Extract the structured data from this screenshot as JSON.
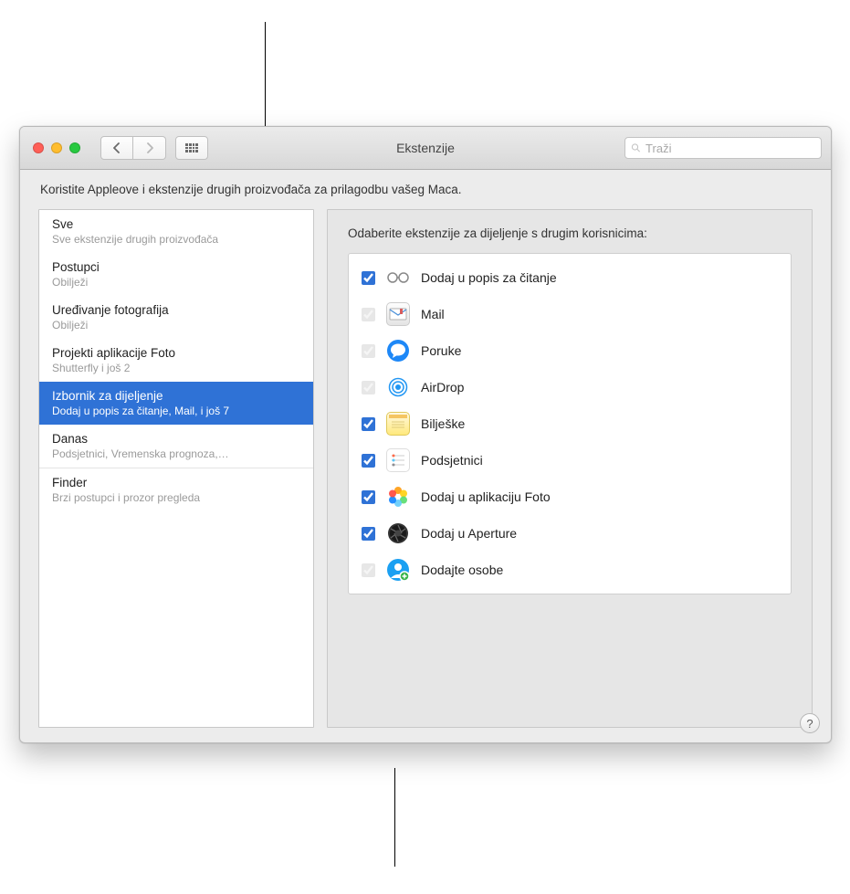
{
  "window": {
    "title": "Ekstenzije"
  },
  "search": {
    "placeholder": "Traži"
  },
  "description": "Koristite Appleove i ekstenzije drugih proizvođača za prilagodbu vašeg Maca.",
  "sidebar": {
    "items": [
      {
        "title": "Sve",
        "sub": "Sve ekstenzije drugih proizvođača"
      },
      {
        "title": "Postupci",
        "sub": "Obilježi"
      },
      {
        "title": "Uređivanje fotografija",
        "sub": "Obilježi"
      },
      {
        "title": "Projekti aplikacije Foto",
        "sub": "Shutterfly i još 2"
      },
      {
        "title": "Izbornik za dijeljenje",
        "sub": "Dodaj u popis za čitanje, Mail, i još 7",
        "selected": true
      },
      {
        "title": "Danas",
        "sub": "Podsjetnici, Vremenska prognoza,…"
      },
      {
        "title": "Finder",
        "sub": "Brzi postupci i prozor pregleda",
        "divided": true
      }
    ]
  },
  "detail": {
    "heading": "Odaberite ekstenzije za dijeljenje s drugim korisnicima:",
    "items": [
      {
        "label": "Dodaj u popis za čitanje",
        "checked": true,
        "disabled": false,
        "icon": "glasses"
      },
      {
        "label": "Mail",
        "checked": true,
        "disabled": true,
        "icon": "mail"
      },
      {
        "label": "Poruke",
        "checked": true,
        "disabled": true,
        "icon": "messages"
      },
      {
        "label": "AirDrop",
        "checked": true,
        "disabled": true,
        "icon": "airdrop"
      },
      {
        "label": "Bilješke",
        "checked": true,
        "disabled": false,
        "icon": "notes"
      },
      {
        "label": "Podsjetnici",
        "checked": true,
        "disabled": false,
        "icon": "reminders"
      },
      {
        "label": "Dodaj u aplikaciju Foto",
        "checked": true,
        "disabled": false,
        "icon": "photos"
      },
      {
        "label": "Dodaj u Aperture",
        "checked": true,
        "disabled": false,
        "icon": "aperture"
      },
      {
        "label": "Dodajte osobe",
        "checked": true,
        "disabled": true,
        "icon": "addpeople"
      }
    ]
  },
  "help": "?"
}
